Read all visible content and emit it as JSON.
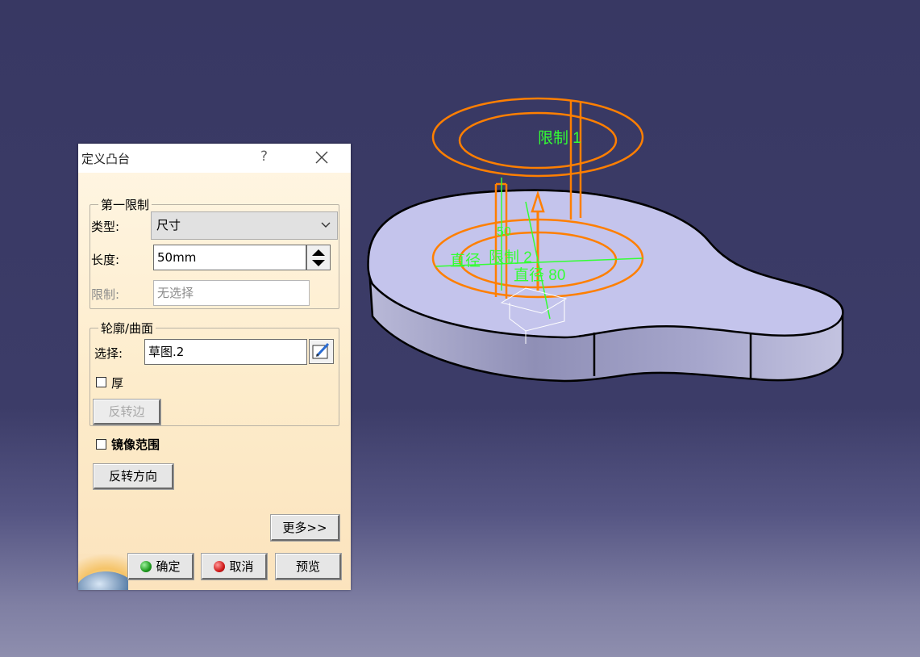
{
  "dialog": {
    "title": "定义凸台",
    "help_icon": "?",
    "first_limit_group": {
      "legend": "第一限制",
      "type_label": "类型:",
      "type_value": "尺寸",
      "length_label": "长度:",
      "length_value": "50mm",
      "limit_label": "限制:",
      "limit_value": "无选择"
    },
    "profile_group": {
      "legend": "轮廓/曲面",
      "select_label": "选择:",
      "select_value": "草图.2",
      "thick_label": "厚",
      "thick_checked": false,
      "reverse_side_label": "反转边"
    },
    "mirror_label": "镜像范围",
    "mirror_checked": false,
    "reverse_direction_label": "反转方向",
    "more_label": "更多>>",
    "ok_label": "确定",
    "cancel_label": "取消",
    "preview_label": "预览"
  },
  "viewport": {
    "annotations": {
      "limit1": "限制 1",
      "limit2": "限制 2",
      "diameter_left": "直径",
      "diameter_right": "直径 80",
      "dimension_vertical": "50"
    }
  },
  "colors": {
    "preview_orange": "#ff7f00",
    "annotation_green": "#33ff33",
    "part_face": "#c4c4ec",
    "background_top": "#383863"
  }
}
